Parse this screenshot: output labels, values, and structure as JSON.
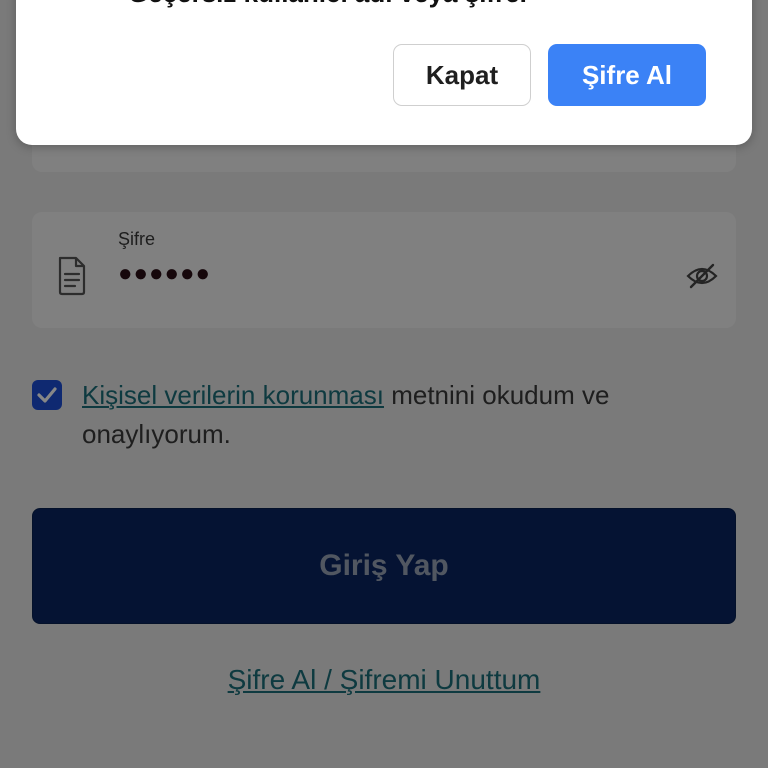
{
  "dialog": {
    "message": "Geçersiz kullanıcı adı veya şifre.",
    "close_label": "Kapat",
    "primary_label": "Şifre Al"
  },
  "password_field": {
    "label": "Şifre",
    "value": "●●●●●●"
  },
  "consent": {
    "checked": true,
    "link_text": "Kişisel verilerin korunması",
    "rest_text": " metnini okudum ve onaylıyorum."
  },
  "login_button": {
    "label": "Giriş Yap"
  },
  "forgot_link": {
    "label": "Şifre Al / Şifremi Unuttum"
  },
  "colors": {
    "accent": "#3b82f6",
    "login_button": "#0b2560",
    "link": "#1b6f7a",
    "checkbox": "#1d4fd6"
  },
  "icons": [
    "document-icon",
    "eye-off-icon",
    "checkmark-icon"
  ]
}
